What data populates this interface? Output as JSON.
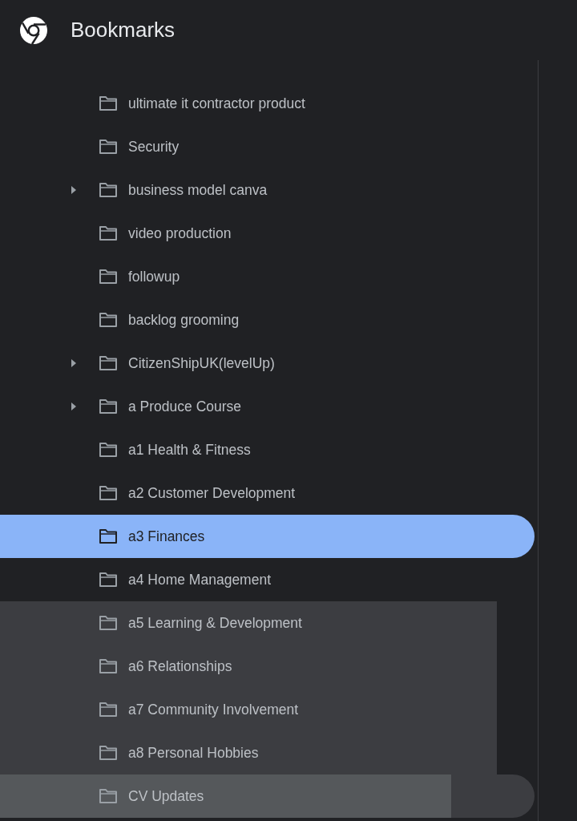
{
  "header": {
    "title": "Bookmarks"
  },
  "items": [
    {
      "label": "ultimate it contractor product",
      "has_children": false,
      "selected": false,
      "shaded": false,
      "hovered": false
    },
    {
      "label": "Security",
      "has_children": false,
      "selected": false,
      "shaded": false,
      "hovered": false
    },
    {
      "label": "business model canva",
      "has_children": true,
      "selected": false,
      "shaded": false,
      "hovered": false
    },
    {
      "label": "video production",
      "has_children": false,
      "selected": false,
      "shaded": false,
      "hovered": false
    },
    {
      "label": "followup",
      "has_children": false,
      "selected": false,
      "shaded": false,
      "hovered": false
    },
    {
      "label": "backlog grooming",
      "has_children": false,
      "selected": false,
      "shaded": false,
      "hovered": false
    },
    {
      "label": "CitizenShipUK(levelUp)",
      "has_children": true,
      "selected": false,
      "shaded": false,
      "hovered": false
    },
    {
      "label": "a Produce Course",
      "has_children": true,
      "selected": false,
      "shaded": false,
      "hovered": false
    },
    {
      "label": "a1 Health & Fitness",
      "has_children": false,
      "selected": false,
      "shaded": false,
      "hovered": false
    },
    {
      "label": "a2 Customer Development",
      "has_children": false,
      "selected": false,
      "shaded": false,
      "hovered": false
    },
    {
      "label": "a3 Finances",
      "has_children": false,
      "selected": true,
      "shaded": false,
      "hovered": false
    },
    {
      "label": "a4 Home Management",
      "has_children": false,
      "selected": false,
      "shaded": false,
      "hovered": false
    },
    {
      "label": "a5 Learning & Development",
      "has_children": false,
      "selected": false,
      "shaded": true,
      "hovered": false
    },
    {
      "label": "a6 Relationships",
      "has_children": false,
      "selected": false,
      "shaded": true,
      "hovered": false
    },
    {
      "label": "a7 Community Involvement",
      "has_children": false,
      "selected": false,
      "shaded": true,
      "hovered": false
    },
    {
      "label": "a8 Personal Hobbies",
      "has_children": false,
      "selected": false,
      "shaded": true,
      "hovered": false
    },
    {
      "label": "CV Updates",
      "has_children": false,
      "selected": false,
      "shaded": false,
      "hovered": true
    }
  ]
}
